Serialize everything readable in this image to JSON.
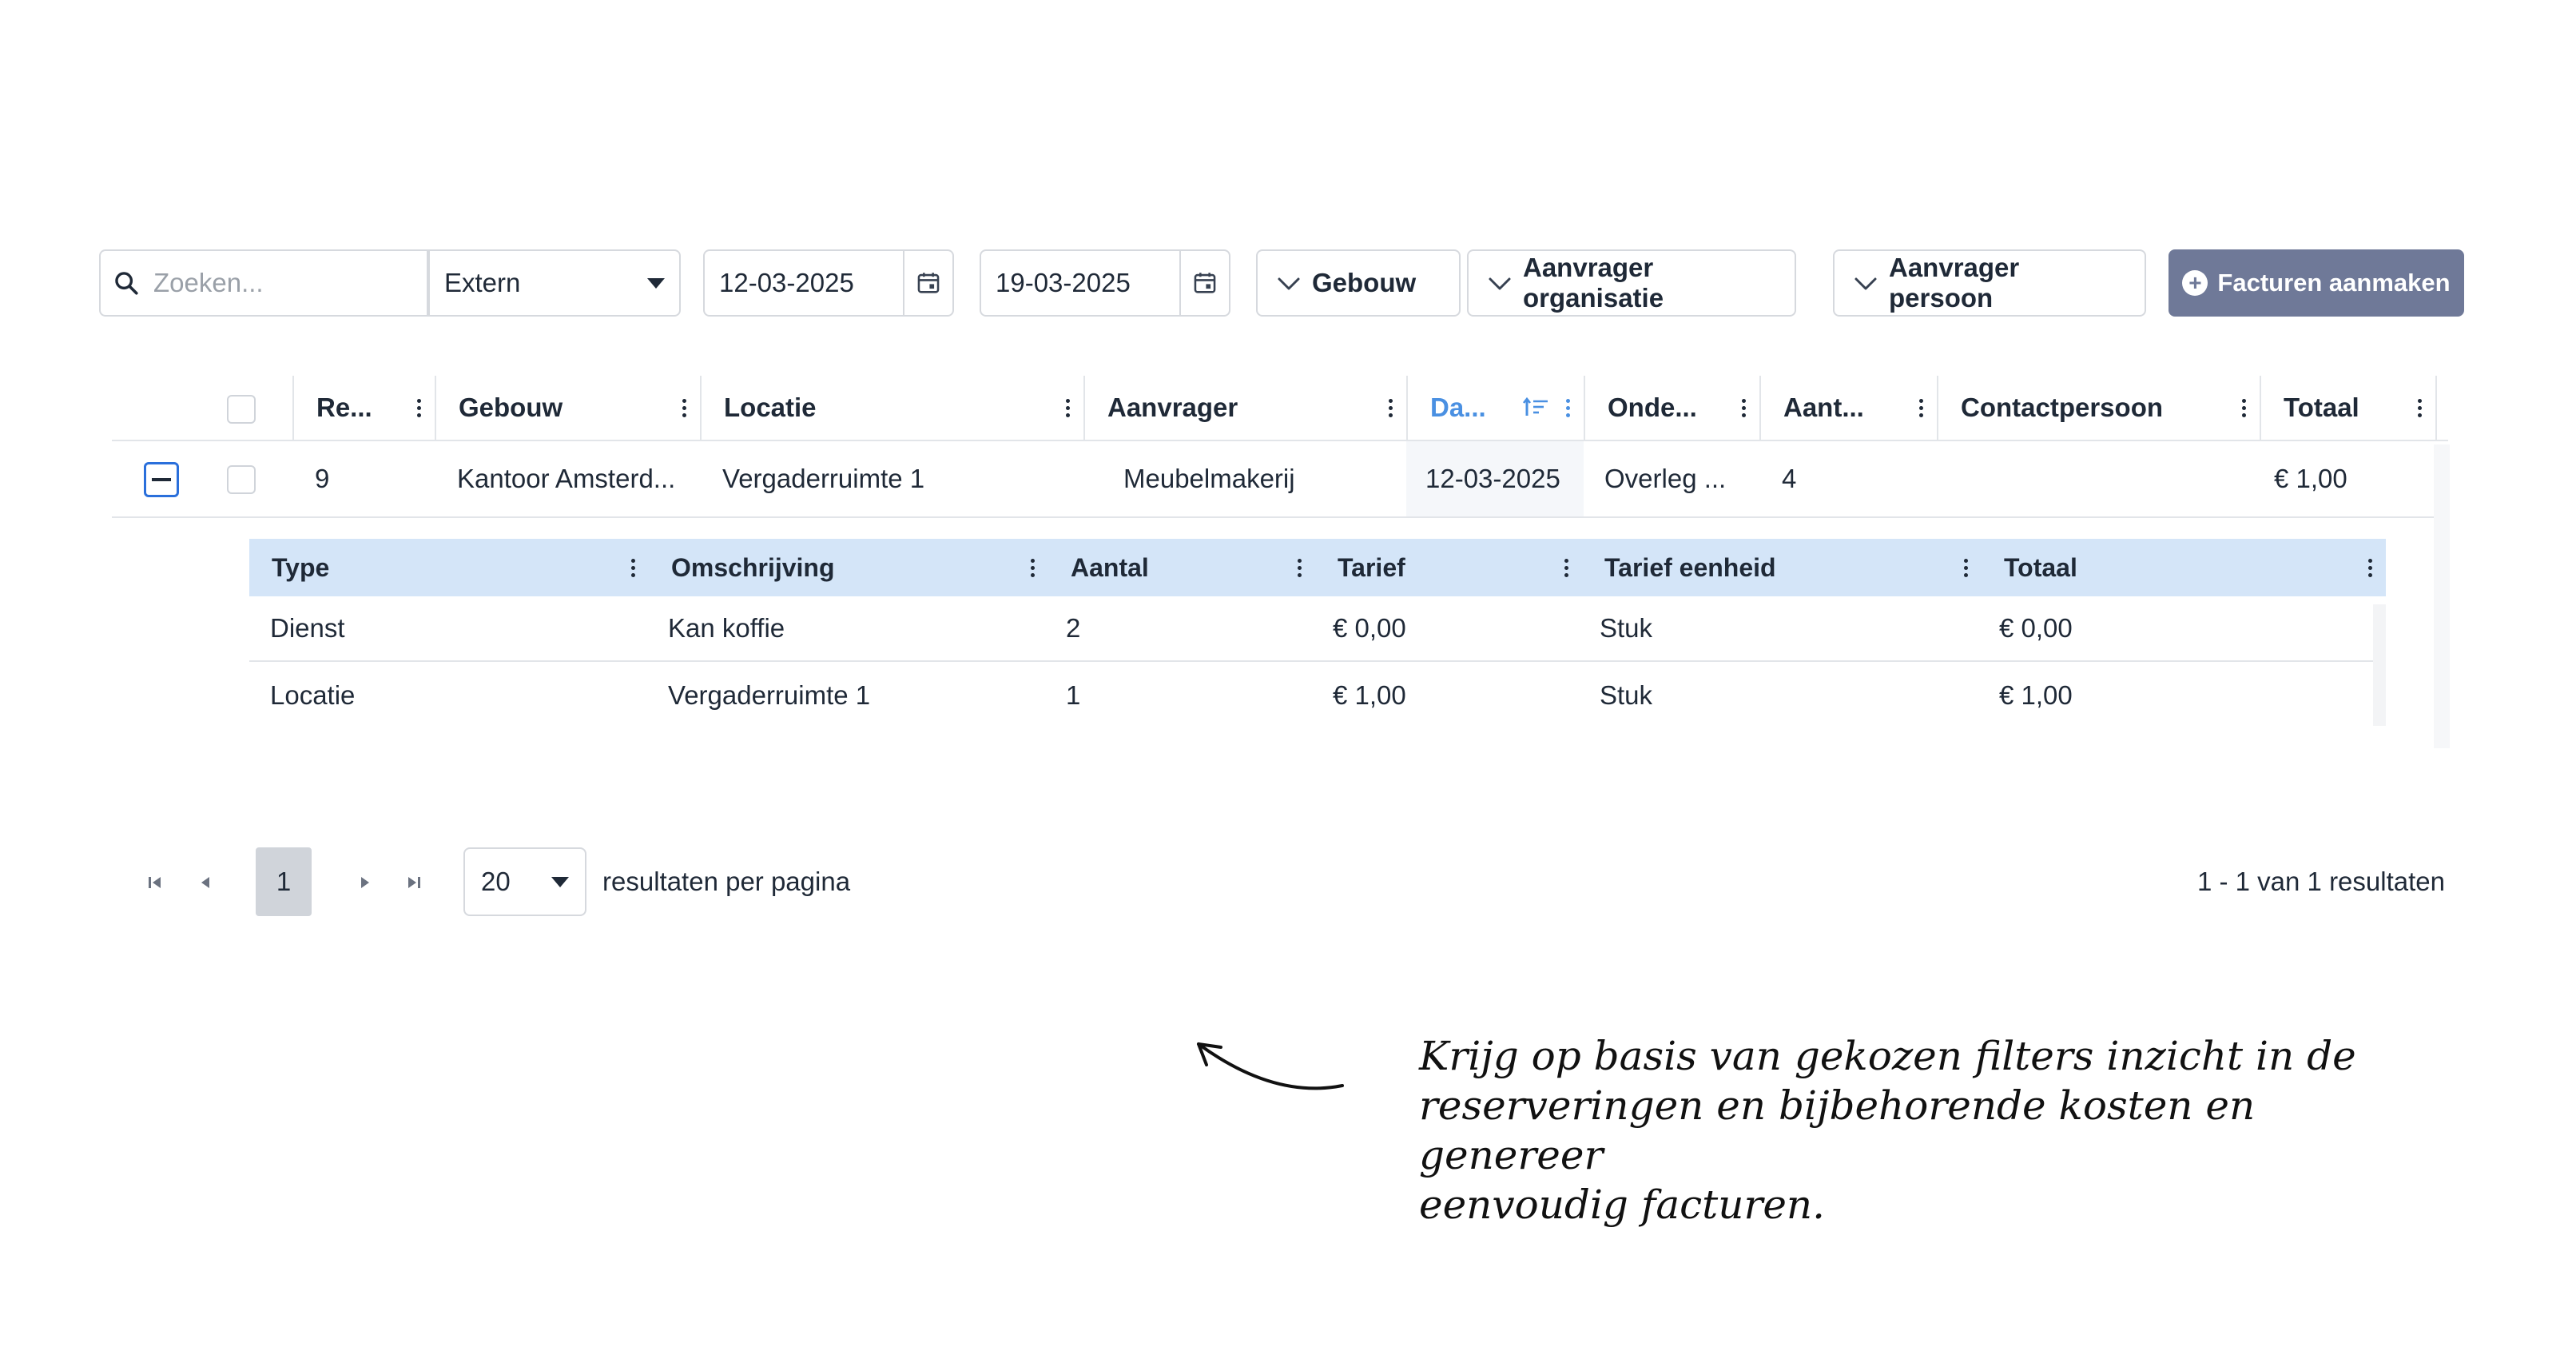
{
  "toolbar": {
    "search_placeholder": "Zoeken...",
    "type_select": "Extern",
    "date_from": "12-03-2025",
    "date_to": "19-03-2025",
    "filter_building": "Gebouw",
    "filter_org": "Aanvrager organisatie",
    "filter_person": "Aanvrager persoon",
    "create_label": "Facturen aanmaken",
    "create_color": "#6f7998"
  },
  "grid": {
    "columns": [
      "Re...",
      "Gebouw",
      "Locatie",
      "Aanvrager",
      "Da...",
      "Onde...",
      "Aant...",
      "Contactpersoon",
      "Totaal"
    ],
    "sorted_column": "Da...",
    "accent_color": "#4a90e2",
    "rows": [
      {
        "nr": "9",
        "gebouw": "Kantoor Amsterd...",
        "locatie": "Vergaderruimte 1",
        "aanvrager": "Meubelmakerij",
        "datum": "12-03-2025",
        "onderwerp": "Overleg ...",
        "aantal": "4",
        "contactpersoon": "",
        "totaal": "€ 1,00"
      }
    ]
  },
  "detail": {
    "columns": [
      "Type",
      "Omschrijving",
      "Aantal",
      "Tarief",
      "Tarief eenheid",
      "Totaal"
    ],
    "header_color": "#d4e5f8",
    "rows": [
      {
        "type": "Dienst",
        "omschrijving": "Kan koffie",
        "aantal": "2",
        "tarief": "€ 0,00",
        "eenheid": "Stuk",
        "totaal": "€ 0,00"
      },
      {
        "type": "Locatie",
        "omschrijving": "Vergaderruimte 1",
        "aantal": "1",
        "tarief": "€ 1,00",
        "eenheid": "Stuk",
        "totaal": "€ 1,00"
      }
    ]
  },
  "pager": {
    "current_page": "1",
    "page_size": "20",
    "per_page_label": "resultaten per pagina",
    "summary": "1 - 1 van 1 resultaten"
  },
  "annotation": {
    "line1": "Krijg op basis van gekozen filters inzicht in de",
    "line2": "reserveringen en bijbehorende kosten en genereer",
    "line3": "eenvoudig facturen."
  }
}
